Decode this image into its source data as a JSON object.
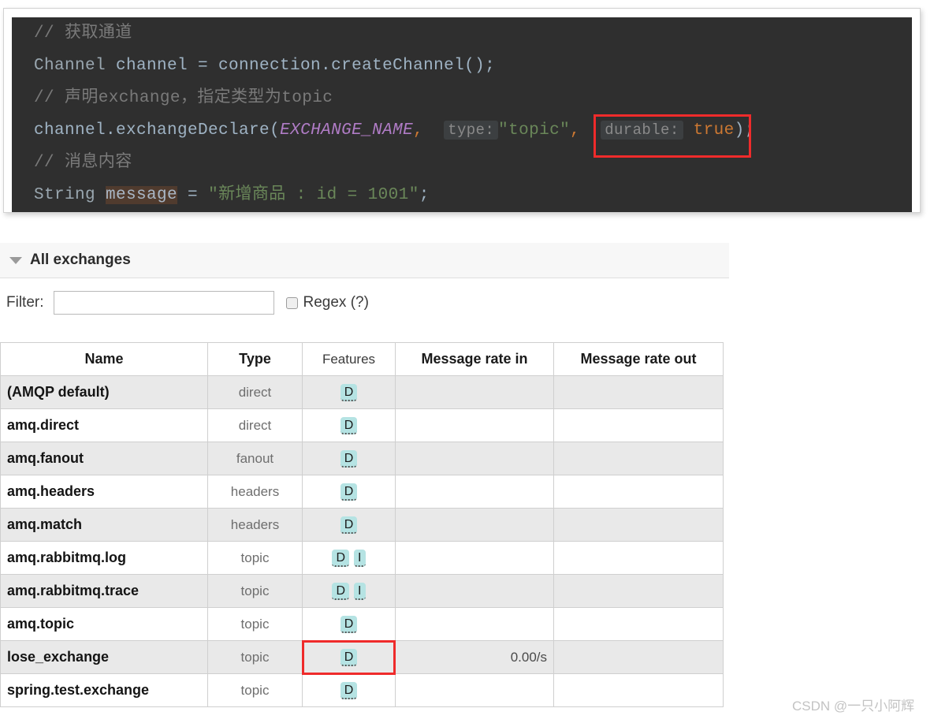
{
  "code_block": {
    "language": "java",
    "lines": [
      {
        "id": "line-1",
        "segments": [
          {
            "cls": "cmt",
            "text": "// 获取通道"
          }
        ]
      },
      {
        "id": "line-2",
        "segments": [
          {
            "cls": "type-id",
            "text": "Channel"
          },
          {
            "cls": "plain",
            "text": " channel = connection."
          },
          {
            "cls": "plain",
            "text": "createChannel"
          },
          {
            "cls": "punct",
            "text": "();"
          }
        ]
      },
      {
        "id": "line-3",
        "segments": [
          {
            "cls": "cmt",
            "text": "// 声明exchange，指定类型为topic"
          }
        ]
      },
      {
        "id": "line-4",
        "segments": [
          {
            "cls": "plain",
            "text": "channel."
          },
          {
            "cls": "plain",
            "text": "exchangeDeclare"
          },
          {
            "cls": "punct",
            "text": "("
          },
          {
            "cls": "const-it",
            "text": "EXCHANGE_NAME"
          },
          {
            "cls": "kw-true",
            "text": ","
          },
          {
            "cls": "plain",
            "text": "  "
          },
          {
            "cls": "hint",
            "text": "type:"
          },
          {
            "cls": "str",
            "text": "\"topic\""
          },
          {
            "cls": "kw-true",
            "text": ","
          },
          {
            "cls": "plain",
            "text": "  "
          },
          {
            "cls": "hint",
            "text": "durable:"
          },
          {
            "cls": "kw-true",
            "text": " true"
          },
          {
            "cls": "punct",
            "text": ");"
          }
        ]
      },
      {
        "id": "line-5",
        "segments": [
          {
            "cls": "cmt",
            "text": "// 消息内容"
          }
        ]
      },
      {
        "id": "line-6",
        "segments": [
          {
            "cls": "type-id",
            "text": "String"
          },
          {
            "cls": "plain",
            "text": " "
          },
          {
            "cls": "hl-ident",
            "text": "message"
          },
          {
            "cls": "plain",
            "text": " = "
          },
          {
            "cls": "str",
            "text": "\"新增商品 : id = 1001\""
          },
          {
            "cls": "punct",
            "text": ";"
          }
        ]
      }
    ],
    "highlight_box_label": "durable: true"
  },
  "panel": {
    "title": "All exchanges",
    "collapse_icon": "triangle-down-icon"
  },
  "filter": {
    "label": "Filter:",
    "value": "",
    "placeholder": "",
    "regex_label": "Regex (?)",
    "regex_checked": false
  },
  "table": {
    "columns": [
      "Name",
      "Type",
      "Features",
      "Message rate in",
      "Message rate out"
    ],
    "rows": [
      {
        "name": "(AMQP default)",
        "type": "direct",
        "features": [
          "D"
        ],
        "rate_in": "",
        "rate_out": ""
      },
      {
        "name": "amq.direct",
        "type": "direct",
        "features": [
          "D"
        ],
        "rate_in": "",
        "rate_out": ""
      },
      {
        "name": "amq.fanout",
        "type": "fanout",
        "features": [
          "D"
        ],
        "rate_in": "",
        "rate_out": ""
      },
      {
        "name": "amq.headers",
        "type": "headers",
        "features": [
          "D"
        ],
        "rate_in": "",
        "rate_out": ""
      },
      {
        "name": "amq.match",
        "type": "headers",
        "features": [
          "D"
        ],
        "rate_in": "",
        "rate_out": ""
      },
      {
        "name": "amq.rabbitmq.log",
        "type": "topic",
        "features": [
          "D",
          "I"
        ],
        "rate_in": "",
        "rate_out": ""
      },
      {
        "name": "amq.rabbitmq.trace",
        "type": "topic",
        "features": [
          "D",
          "I"
        ],
        "rate_in": "",
        "rate_out": ""
      },
      {
        "name": "amq.topic",
        "type": "topic",
        "features": [
          "D"
        ],
        "rate_in": "",
        "rate_out": ""
      },
      {
        "name": "lose_exchange",
        "type": "topic",
        "features": [
          "D"
        ],
        "rate_in": "0.00/s",
        "rate_out": ""
      },
      {
        "name": "spring.test.exchange",
        "type": "topic",
        "features": [
          "D"
        ],
        "rate_in": "",
        "rate_out": ""
      }
    ]
  },
  "annotations": {
    "accent_red": "#ef2b2b",
    "badge_bg": "#b5e3e3"
  },
  "watermark": "CSDN @一只小阿辉"
}
